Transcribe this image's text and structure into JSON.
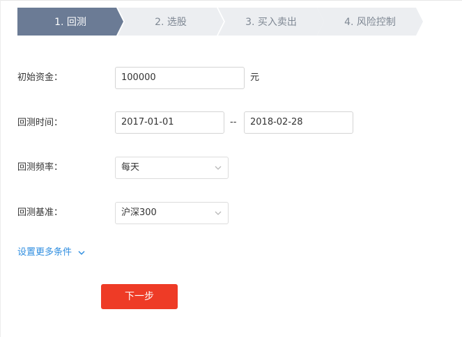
{
  "steps": [
    {
      "label": "1. 回测",
      "active": true
    },
    {
      "label": "2. 选股",
      "active": false
    },
    {
      "label": "3. 买入卖出",
      "active": false
    },
    {
      "label": "4. 风险控制",
      "active": false
    }
  ],
  "colors": {
    "step_active": "#6b7b95",
    "step_inactive": "#eceef1",
    "primary_button": "#ee3b26",
    "link": "#2f8ee0"
  },
  "form": {
    "capital_label": "初始资金：",
    "capital_value": "100000",
    "capital_unit": "元",
    "period_label": "回测时间：",
    "start_date": "2017-01-01",
    "date_separator": "--",
    "end_date": "2018-02-28",
    "frequency_label": "回测频率：",
    "frequency_value": "每天",
    "benchmark_label": "回测基准：",
    "benchmark_value": "沪深300"
  },
  "more_conditions": "设置更多条件",
  "next_button": "下一步"
}
